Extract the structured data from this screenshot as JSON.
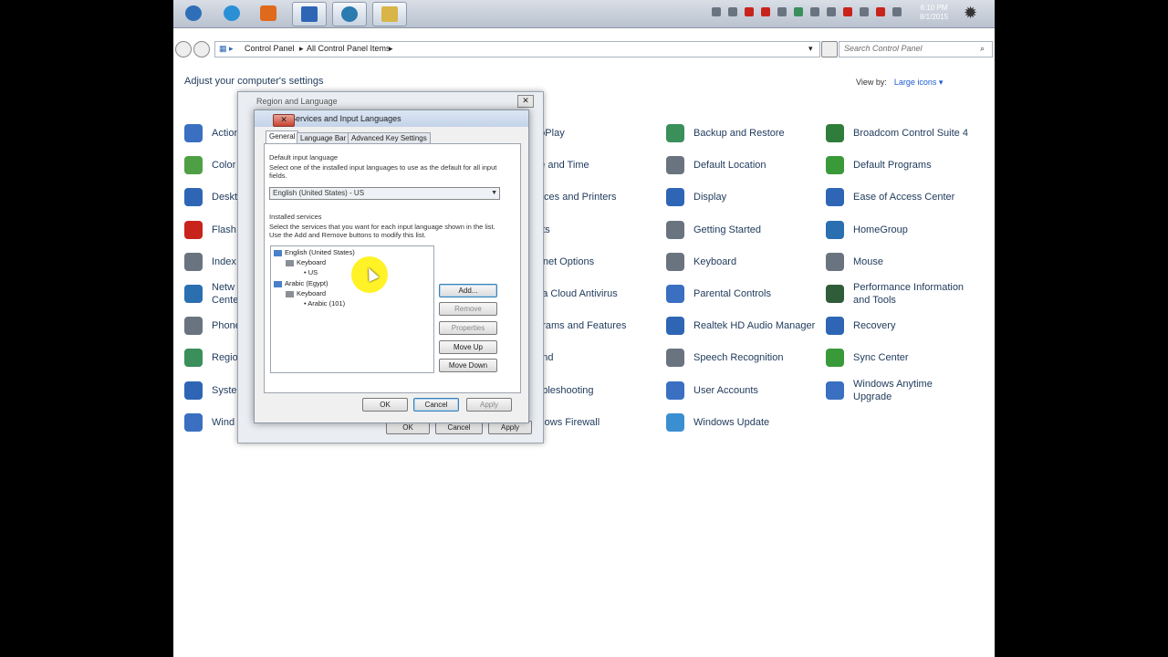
{
  "taskbar": {
    "buttons": [
      {
        "icon": "start-orb-icon",
        "color": "#2f6fb8"
      },
      {
        "icon": "internet-explorer-icon",
        "color": "#2b8fd6"
      },
      {
        "icon": "media-player-icon",
        "color": "#e06a1c"
      },
      {
        "icon": "window-icon",
        "color": "#2e66b5"
      },
      {
        "icon": "network-globe-icon",
        "color": "#2b7ab0"
      },
      {
        "icon": "folder-icon",
        "color": "#d9b447"
      }
    ],
    "clock": {
      "time": "6:10 PM",
      "date": "8/1/2015"
    }
  },
  "address": {
    "crumbs": [
      "Control Panel",
      "All Control Panel Items"
    ],
    "search_placeholder": "Search Control Panel"
  },
  "heading": "Adjust your computer's settings",
  "view_by": {
    "label": "View by:",
    "value": "Large icons ▾"
  },
  "items_col1": [
    {
      "label": "Action",
      "color": "#3a6fc2"
    },
    {
      "label": "Color",
      "color": "#4fa045"
    },
    {
      "label": "Deskt",
      "color": "#2e66b5"
    },
    {
      "label": "Flash",
      "color": "#c8241c"
    },
    {
      "label": "Index",
      "color": "#6a7480"
    },
    {
      "label": "Netw\nCente",
      "color": "#2b6fb1"
    },
    {
      "label": "Phone",
      "color": "#6a7480"
    },
    {
      "label": "Regio",
      "color": "#3a8f5a"
    },
    {
      "label": "Syste",
      "color": "#2e66b5"
    },
    {
      "label": "Wind",
      "color": "#3a6fc2"
    }
  ],
  "items_col2": [
    {
      "label": "utoPlay",
      "color": "#3a7fc2"
    },
    {
      "label": "ate and Time",
      "color": "#6a7480"
    },
    {
      "label": "evices and Printers",
      "color": "#6a7480"
    },
    {
      "label": "onts",
      "color": "#c9a43a"
    },
    {
      "label": "ternet Options",
      "color": "#2b8fd6"
    },
    {
      "label": "nda Cloud Antivirus",
      "color": "#333"
    },
    {
      "label": "ograms and Features",
      "color": "#6a7480"
    },
    {
      "label": "ound",
      "color": "#6a7480"
    },
    {
      "label": "oubleshooting",
      "color": "#2e66b5"
    },
    {
      "label": "indows Firewall",
      "color": "#c8582c"
    }
  ],
  "items_col3": [
    {
      "label": "Backup and Restore",
      "color": "#3a8f5a"
    },
    {
      "label": "Default Location",
      "color": "#6a7480"
    },
    {
      "label": "Display",
      "color": "#2e66b5"
    },
    {
      "label": "Getting Started",
      "color": "#6a7480"
    },
    {
      "label": "Keyboard",
      "color": "#6a7480"
    },
    {
      "label": "Parental Controls",
      "color": "#3a6fc2"
    },
    {
      "label": "Realtek HD Audio Manager",
      "color": "#2e66b5"
    },
    {
      "label": "Speech Recognition",
      "color": "#6a7480"
    },
    {
      "label": "User Accounts",
      "color": "#3a6fc2"
    },
    {
      "label": "Windows Update",
      "color": "#3a8fd0"
    }
  ],
  "items_col4": [
    {
      "label": "Broadcom Control Suite 4",
      "color": "#2f7d3a"
    },
    {
      "label": "Default Programs",
      "color": "#3a9a3a"
    },
    {
      "label": "Ease of Access Center",
      "color": "#2e66b5"
    },
    {
      "label": "HomeGroup",
      "color": "#2b6fb1"
    },
    {
      "label": "Mouse",
      "color": "#6a7480"
    },
    {
      "label": "Performance Information\nand Tools",
      "color": "#2f5d3a"
    },
    {
      "label": "Recovery",
      "color": "#2e66b5"
    },
    {
      "label": "Sync Center",
      "color": "#3a9a3a"
    },
    {
      "label": "Windows Anytime\nUpgrade",
      "color": "#3a6fc2"
    }
  ],
  "outer_dialog": {
    "title": "Region and Language",
    "ok": "OK",
    "cancel": "Cancel",
    "apply": "Apply"
  },
  "inner_dialog": {
    "title": "Text Services and Input Languages",
    "tabs": [
      "General",
      "Language Bar",
      "Advanced Key Settings"
    ],
    "default_label": "Default input language",
    "default_desc": "Select one of the installed input languages to use as the default for all input fields.",
    "default_value": "English (United States) - US",
    "installed_label": "Installed services",
    "installed_desc": "Select the services that you want for each input language shown in the list. Use the Add and Remove buttons to modify this list.",
    "tree": [
      {
        "text": "English (United States)",
        "level": 0
      },
      {
        "text": "Keyboard",
        "level": 1
      },
      {
        "text": "US",
        "level": 2
      },
      {
        "text": "Arabic (Egypt)",
        "level": 0
      },
      {
        "text": "Keyboard",
        "level": 1
      },
      {
        "text": "Arabic (101)",
        "level": 2
      }
    ],
    "buttons": {
      "add": "Add...",
      "remove": "Remove",
      "properties": "Properties",
      "move_up": "Move Up",
      "move_down": "Move Down"
    },
    "ok": "OK",
    "cancel": "Cancel",
    "apply": "Apply"
  }
}
